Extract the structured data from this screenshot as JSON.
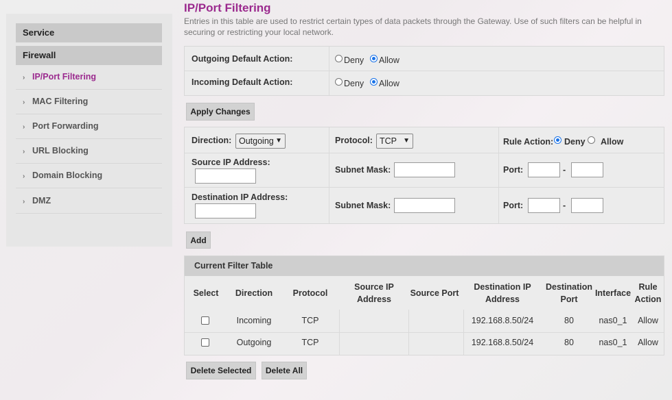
{
  "sidebar": {
    "service": "Service",
    "firewall": "Firewall",
    "items": [
      {
        "label": "IP/Port Filtering",
        "active": true
      },
      {
        "label": "MAC Filtering"
      },
      {
        "label": "Port Forwarding"
      },
      {
        "label": "URL Blocking"
      },
      {
        "label": "Domain Blocking"
      },
      {
        "label": "DMZ"
      }
    ],
    "chevron": "›"
  },
  "page": {
    "title": "IP/Port Filtering",
    "description": "Entries in this table are used to restrict certain types of data packets through the Gateway. Use of such filters can be helpful in securing or restricting your local network."
  },
  "defaults": {
    "outgoing_label": "Outgoing Default Action:",
    "incoming_label": "Incoming Default Action:",
    "deny": "Deny",
    "allow": "Allow",
    "outgoing_value": "Allow",
    "incoming_value": "Allow",
    "apply_button": "Apply Changes"
  },
  "rule": {
    "direction_label": "Direction:",
    "direction_value": "Outgoing",
    "protocol_label": "Protocol:",
    "protocol_value": "TCP",
    "rule_action_label": "Rule Action:",
    "rule_action_value": "Deny",
    "deny": "Deny",
    "allow": "Allow",
    "source_ip_label": "Source IP Address:",
    "dest_ip_label": "Destination IP Address:",
    "subnet_label": "Subnet Mask:",
    "port_label": "Port:",
    "dash": "-",
    "add_button": "Add"
  },
  "table": {
    "title": "Current Filter Table",
    "headers": {
      "select": "Select",
      "direction": "Direction",
      "protocol": "Protocol",
      "source_ip_1": "Source IP",
      "source_ip_2": "Address",
      "source_port": "Source Port",
      "dest_ip_1": "Destination IP",
      "dest_ip_2": "Address",
      "dest_port_1": "Destination",
      "dest_port_2": "Port",
      "interface": "Interface",
      "rule_action_1": "Rule",
      "rule_action_2": "Action"
    },
    "rows": [
      {
        "direction": "Incoming",
        "protocol": "TCP",
        "source_ip": "",
        "source_port": "",
        "dest_ip": "192.168.8.50/24",
        "dest_port": "80",
        "interface": "nas0_1",
        "action": "Allow"
      },
      {
        "direction": "Outgoing",
        "protocol": "TCP",
        "source_ip": "",
        "source_port": "",
        "dest_ip": "192.168.8.50/24",
        "dest_port": "80",
        "interface": "nas0_1",
        "action": "Allow"
      }
    ],
    "delete_selected": "Delete Selected",
    "delete_all": "Delete All"
  }
}
